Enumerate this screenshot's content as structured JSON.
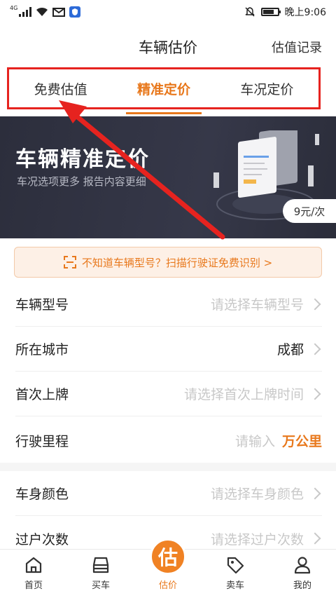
{
  "status_bar": {
    "network_label": "4G",
    "time": "晚上9:06"
  },
  "nav": {
    "title": "车辆估价",
    "right_action": "估值记录"
  },
  "tabs": [
    {
      "label": "免费估值",
      "active": false
    },
    {
      "label": "精准定价",
      "active": true
    },
    {
      "label": "车况定价",
      "active": false
    }
  ],
  "banner": {
    "title": "车辆精准定价",
    "subtitle": "车况选项更多 报告内容更细",
    "price": "9元/次"
  },
  "scan": {
    "text": "不知道车辆型号？扫描行驶证免费识别 >"
  },
  "form": {
    "model": {
      "label": "车辆型号",
      "placeholder": "请选择车辆型号"
    },
    "city": {
      "label": "所在城市",
      "value": "成都"
    },
    "first_reg": {
      "label": "首次上牌",
      "placeholder": "请选择首次上牌时间"
    },
    "mileage": {
      "label": "行驶里程",
      "placeholder": "请输入",
      "unit": "万公里"
    },
    "color": {
      "label": "车身颜色",
      "placeholder": "请选择车身颜色"
    },
    "transfers": {
      "label": "过户次数",
      "placeholder": "请选择过户次数"
    }
  },
  "bottom_nav": [
    {
      "label": "首页",
      "icon": "home-icon"
    },
    {
      "label": "买车",
      "icon": "car-icon"
    },
    {
      "label": "估价",
      "icon": "estimate-icon",
      "badge": "估",
      "active": true
    },
    {
      "label": "卖车",
      "icon": "tag-icon"
    },
    {
      "label": "我的",
      "icon": "user-icon"
    }
  ],
  "colors": {
    "accent": "#e8781c",
    "highlight_box": "#e6231f",
    "banner_bg": "#2c2e3c"
  }
}
